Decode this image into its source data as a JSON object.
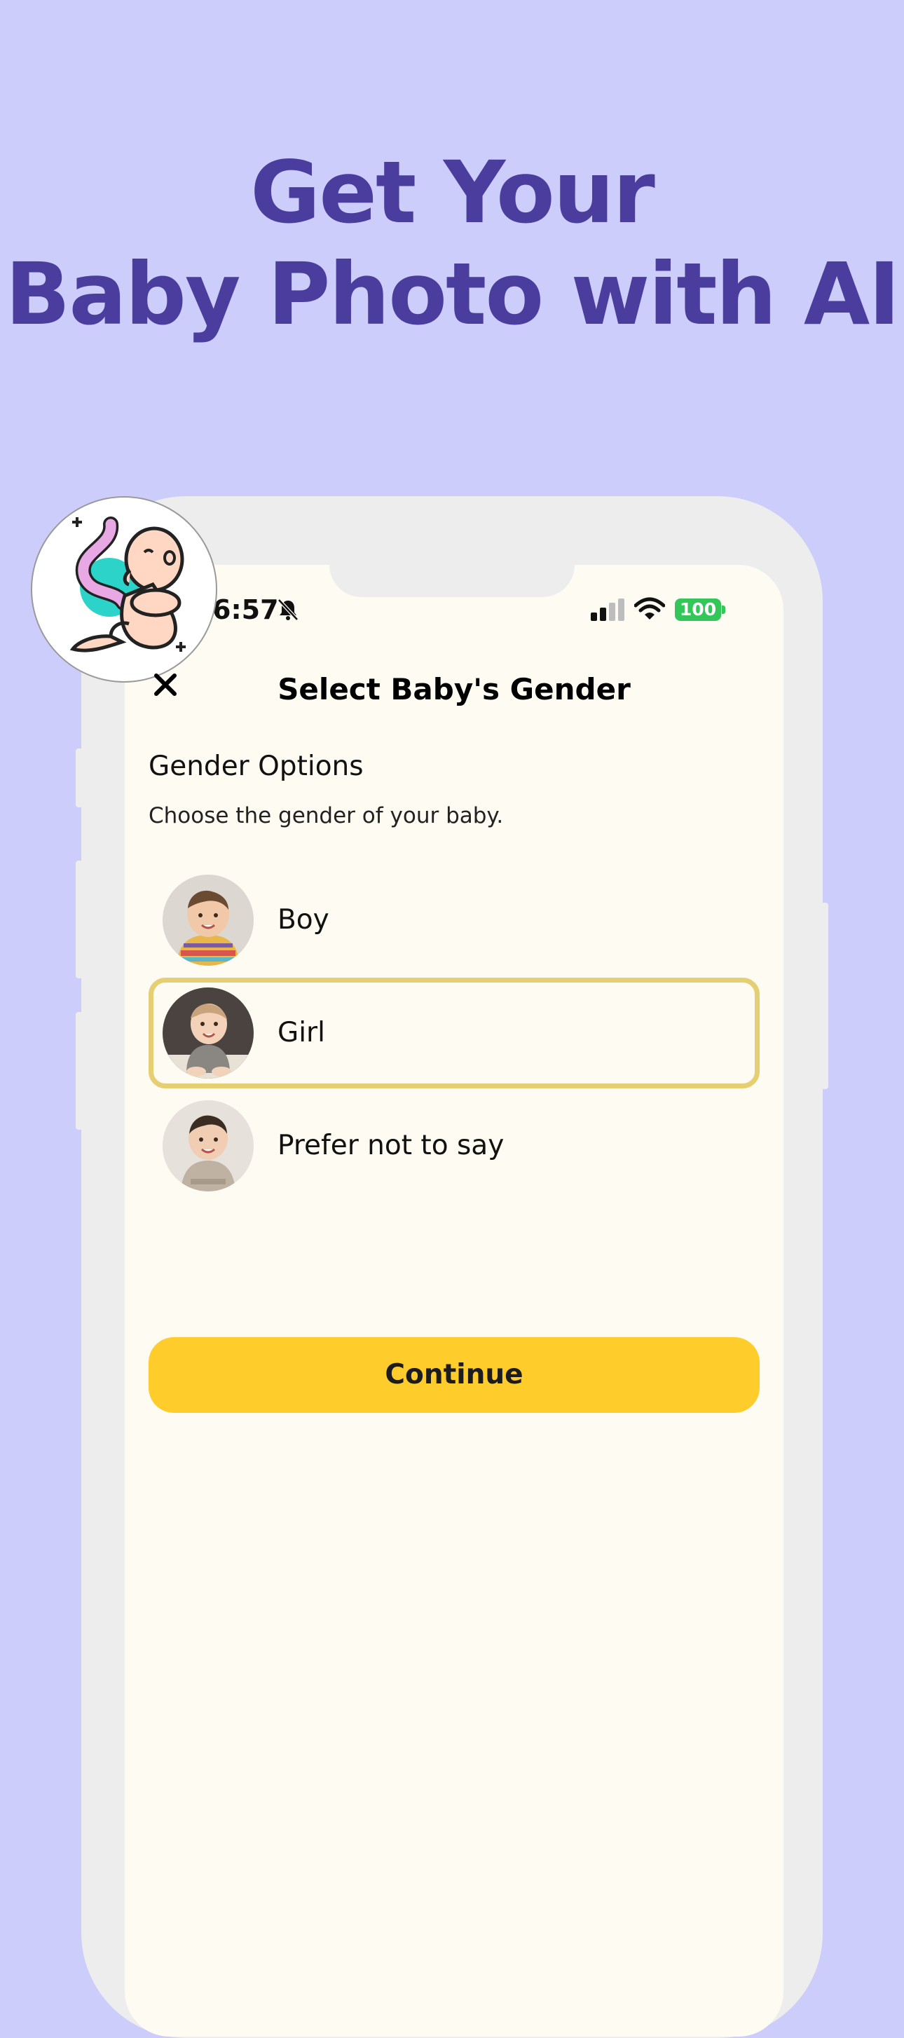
{
  "headline": {
    "line1": "Get Your",
    "line2": "Baby Photo with AI"
  },
  "status_bar": {
    "time": "6:57",
    "battery": "100"
  },
  "modal": {
    "title": "Select Baby's Gender"
  },
  "section": {
    "title": "Gender Options",
    "description": "Choose the gender of your baby."
  },
  "options": [
    {
      "label": "Boy",
      "selected": false
    },
    {
      "label": "Girl",
      "selected": true
    },
    {
      "label": "Prefer not to say",
      "selected": false
    }
  ],
  "continue_label": "Continue",
  "colors": {
    "background": "#cdcdfb",
    "headline": "#4a3d9d",
    "screen": "#fdfbf2",
    "accent_button": "#fecd2c",
    "selected_border": "#e6cf73",
    "battery": "#33c759"
  },
  "icons": [
    "app-logo-baby-icon",
    "bell-slash-icon",
    "signal-icon",
    "wifi-icon",
    "battery-icon",
    "close-icon"
  ]
}
